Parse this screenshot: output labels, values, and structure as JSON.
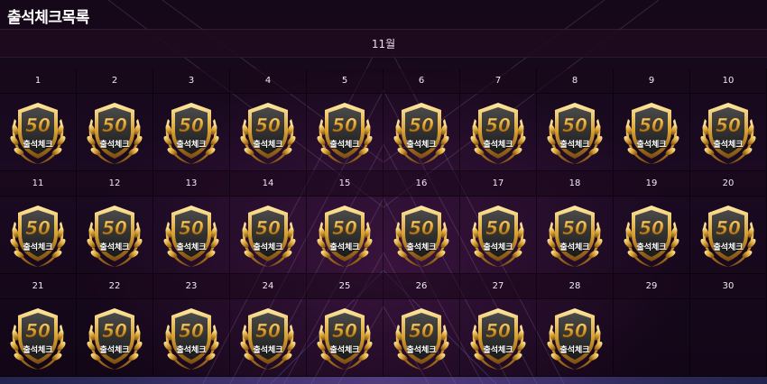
{
  "header": {
    "title": "출석체크목록"
  },
  "calendar": {
    "month_label": "11월",
    "badge_text": "출석체크",
    "badge_icon": "attendance-50-badge-icon",
    "colors": {
      "gold": "#d9a233",
      "gold_light": "#ffe9a3",
      "shield": "#1a1a1a"
    },
    "days": [
      {
        "num": "1",
        "checked": true
      },
      {
        "num": "2",
        "checked": true
      },
      {
        "num": "3",
        "checked": true
      },
      {
        "num": "4",
        "checked": true
      },
      {
        "num": "5",
        "checked": true
      },
      {
        "num": "6",
        "checked": true
      },
      {
        "num": "7",
        "checked": true
      },
      {
        "num": "8",
        "checked": true
      },
      {
        "num": "9",
        "checked": true
      },
      {
        "num": "10",
        "checked": true
      },
      {
        "num": "11",
        "checked": true
      },
      {
        "num": "12",
        "checked": true
      },
      {
        "num": "13",
        "checked": true
      },
      {
        "num": "14",
        "checked": true
      },
      {
        "num": "15",
        "checked": true
      },
      {
        "num": "16",
        "checked": true
      },
      {
        "num": "17",
        "checked": true
      },
      {
        "num": "18",
        "checked": true
      },
      {
        "num": "19",
        "checked": true
      },
      {
        "num": "20",
        "checked": true
      },
      {
        "num": "21",
        "checked": true
      },
      {
        "num": "22",
        "checked": true
      },
      {
        "num": "23",
        "checked": true
      },
      {
        "num": "24",
        "checked": true
      },
      {
        "num": "25",
        "checked": true
      },
      {
        "num": "26",
        "checked": true
      },
      {
        "num": "27",
        "checked": true
      },
      {
        "num": "28",
        "checked": true
      },
      {
        "num": "29",
        "checked": false
      },
      {
        "num": "30",
        "checked": false
      }
    ]
  }
}
